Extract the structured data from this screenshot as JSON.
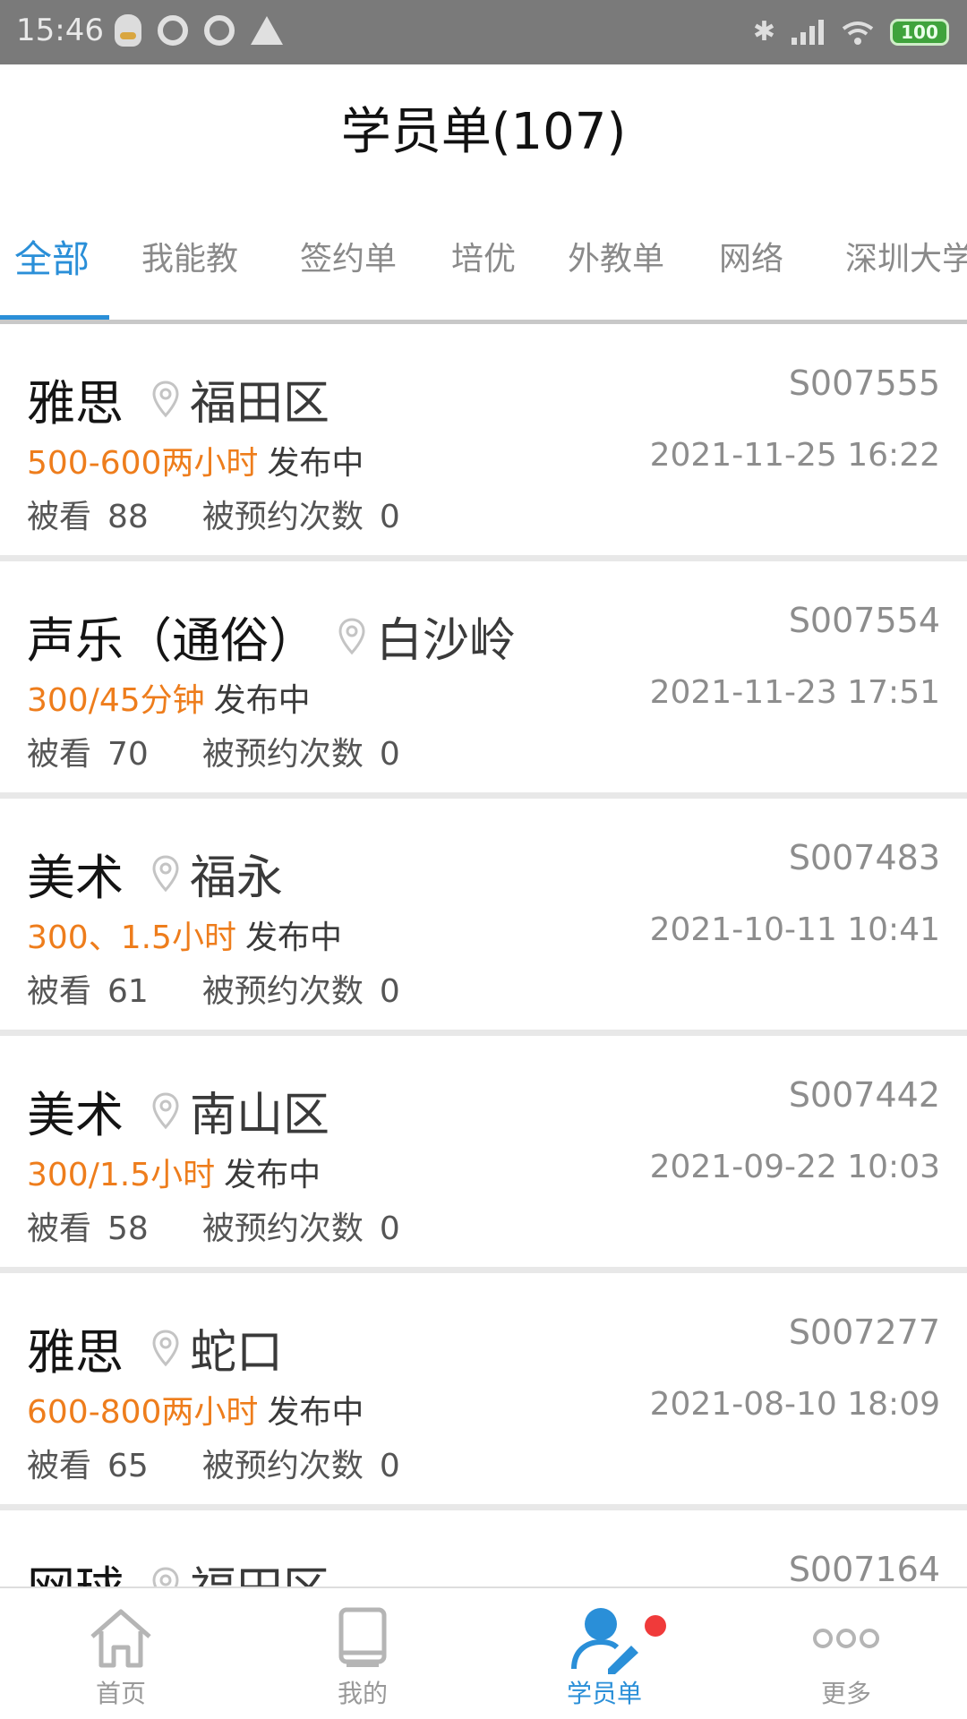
{
  "status_bar": {
    "time": "15:46",
    "battery": "100"
  },
  "header": {
    "title": "学员单(107)"
  },
  "tabs": [
    {
      "label": "全部",
      "active": true
    },
    {
      "label": "我能教"
    },
    {
      "label": "签约单"
    },
    {
      "label": "培优"
    },
    {
      "label": "外教单"
    },
    {
      "label": "网络"
    },
    {
      "label": "深圳大学"
    }
  ],
  "items": [
    {
      "subject": "雅思",
      "location": "福田区",
      "code": "S007555",
      "price": "500-600两小时",
      "status": "发布中",
      "datetime": "2021-11-25 16:22",
      "views_label": "被看",
      "views": "88",
      "booked_label": "被预约次数",
      "booked": "0"
    },
    {
      "subject": "声乐（通俗）",
      "location": "白沙岭",
      "code": "S007554",
      "price": "300/45分钟",
      "status": "发布中",
      "datetime": "2021-11-23 17:51",
      "views_label": "被看",
      "views": "70",
      "booked_label": "被预约次数",
      "booked": "0"
    },
    {
      "subject": "美术",
      "location": "福永",
      "code": "S007483",
      "price": "300、1.5小时",
      "status": "发布中",
      "datetime": "2021-10-11 10:41",
      "views_label": "被看",
      "views": "61",
      "booked_label": "被预约次数",
      "booked": "0"
    },
    {
      "subject": "美术",
      "location": "南山区",
      "code": "S007442",
      "price": "300/1.5小时",
      "status": "发布中",
      "datetime": "2021-09-22 10:03",
      "views_label": "被看",
      "views": "58",
      "booked_label": "被预约次数",
      "booked": "0"
    },
    {
      "subject": "雅思",
      "location": "蛇口",
      "code": "S007277",
      "price": "600-800两小时",
      "status": "发布中",
      "datetime": "2021-08-10 18:09",
      "views_label": "被看",
      "views": "65",
      "booked_label": "被预约次数",
      "booked": "0"
    },
    {
      "subject": "网球",
      "location": "福田区",
      "code": "S007164",
      "price": "",
      "status": "",
      "datetime": "",
      "views_label": "",
      "views": "",
      "booked_label": "",
      "booked": ""
    }
  ],
  "bottom_nav": [
    {
      "label": "首页",
      "icon": "home-icon"
    },
    {
      "label": "我的",
      "icon": "book-icon"
    },
    {
      "label": "学员单",
      "icon": "student-edit-icon",
      "active": true
    },
    {
      "label": "更多",
      "icon": "more-dots-icon"
    }
  ],
  "colors": {
    "accent": "#2a8fd8",
    "price": "#ee7d1c",
    "badge": "#f03a3a"
  }
}
